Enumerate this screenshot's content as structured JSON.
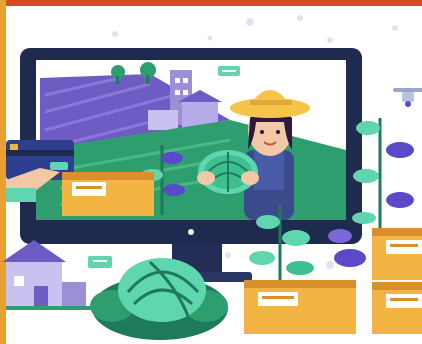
{
  "illustration": {
    "subject": "farmer-video-call",
    "colors": {
      "frame_top": "#d9481e",
      "frame_left": "#e8a12e",
      "monitor_bezel": "#1f2a4f",
      "monitor_stand": "#232d55",
      "sky": "#ffffff",
      "field_purple": "#6f5bc4",
      "field_green": "#2e9e6e",
      "leaf_green": "#5fd6b0",
      "leaf_dark": "#1f7a5b",
      "leaf_purple": "#5a49c9",
      "box_orange": "#f2b544",
      "box_dark": "#d98f2b",
      "hat_yellow": "#f6c44b",
      "shirt_blue": "#3a4a8a",
      "card_blue": "#2f3f8f"
    }
  }
}
